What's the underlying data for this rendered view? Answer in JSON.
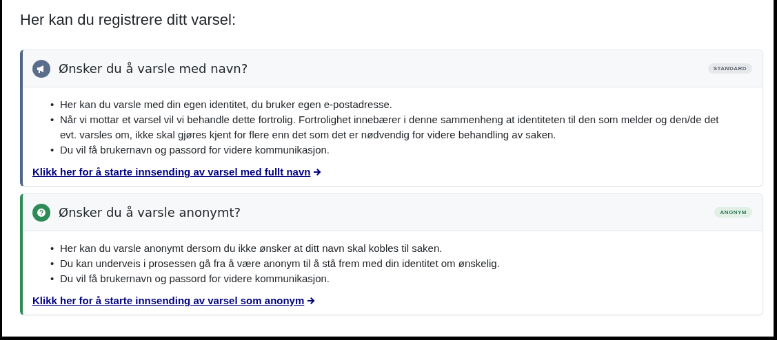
{
  "heading": "Her kan du registrere ditt varsel:",
  "cards": [
    {
      "kind": "named",
      "title": "Ønsker du å varsle med navn?",
      "badge": "STANDARD",
      "bullets": [
        {
          "marker": "•",
          "text": "Her kan du varsle med din egen identitet, du bruker egen e-postadresse."
        },
        {
          "marker": "•",
          "text": "Når vi mottar et varsel vil vi behandle dette fortrolig. Fortrolighet innebærer i denne sammenheng at identiteten til den som melder og den/de det evt. varsles om, ikke skal gjøres kjent for flere enn det som det er nødvendig for videre behandling av saken."
        },
        {
          "marker": "•",
          "text": "Du vil få brukernavn og passord for videre kommunikasjon."
        }
      ],
      "link": "Klikk her for å starte innsending av varsel med fullt navn"
    },
    {
      "kind": "anonymous",
      "title": "Ønsker du å varsle anonymt?",
      "badge": "ANONYM",
      "bullets": [
        {
          "marker": "•",
          "text": "Her kan du varsle anonymt dersom du ikke ønsker at ditt navn skal kobles til saken."
        },
        {
          "marker": "•",
          "text": "Du kan underveis i prosessen gå fra å være anonym til å stå frem med din identitet om ønskelig."
        },
        {
          "marker": "•",
          "text": "Du vil få brukernavn og passord for videre kommunikasjon."
        }
      ],
      "link": "Klikk her for å starte innsending av varsel som anonym"
    }
  ]
}
